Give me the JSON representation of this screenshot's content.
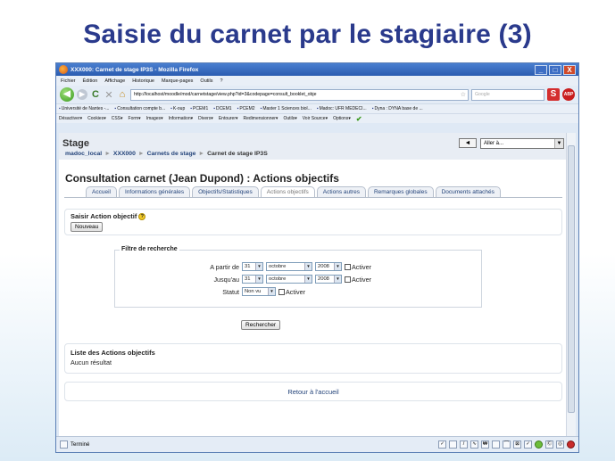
{
  "slide": {
    "title": "Saisie du carnet par le stagiaire (3)"
  },
  "window": {
    "title": "XXX000: Carnet de stage IP3S - Mozilla Firefox",
    "min": "_",
    "max": "□",
    "close": "X"
  },
  "menu": [
    "Fichier",
    "Édition",
    "Affichage",
    "Historique",
    "Marque-pages",
    "Outils",
    "?"
  ],
  "nav": {
    "back": "◀",
    "forward": "▶",
    "reload": "C",
    "stop": "✕",
    "home": "⌂",
    "url": "http://localhost/moodle/mod/carnetstage/view.php?id=3&codepage=consult_booklet_obje",
    "search_placeholder": "Google",
    "s_icon": "S",
    "abp_icon": "ABP"
  },
  "bookmarks": [
    "Université de Nantes -...",
    "Consultation compte b...",
    "K-oup",
    "PCEM1",
    "DCEM1",
    "PCEM2",
    "Master 1 Sciences biol...",
    "Madoc: UFR MEDECI...",
    "Dyna : DYNA base de ..."
  ],
  "addons": [
    "Désactiver▾",
    "Cookies▾",
    "CSS▾",
    "Form▾",
    "Images▾",
    "Information▾",
    "Divers▾",
    "Entourer▾",
    "Redimensionner▾",
    "Outils▾",
    "Voir Source▾",
    "Options▾"
  ],
  "page": {
    "site_name": "Stage",
    "jump_arrow": "◄",
    "jump_placeholder": "Aller à...",
    "breadcrumb": [
      "madoc_local",
      "XXX000",
      "Carnets de stage",
      "Carnet de stage IP3S"
    ],
    "heading": "Consultation carnet (Jean Dupond) : Actions objectifs",
    "tabs": [
      "Accueil",
      "Informations générales",
      "Objectifs/Statistiques",
      "Actions objectifs",
      "Actions autres",
      "Remarques globales",
      "Documents attachés"
    ],
    "active_tab": 3,
    "saisir_label": "Saisir Action objectif",
    "help_icon": "?",
    "new_button": "Nouveau",
    "filter": {
      "legend": "Filtre de recherche",
      "from_label": "A partir de",
      "to_label": "Jusqu'au",
      "status_label": "Statut",
      "from": {
        "day": "31",
        "month": "octobre",
        "year": "2008"
      },
      "to": {
        "day": "31",
        "month": "octobre",
        "year": "2008"
      },
      "activate": "Activer",
      "status_value": "Non vu",
      "search_button": "Rechercher"
    },
    "list_title": "Liste des Actions objectifs",
    "list_empty": "Aucun résultat",
    "back_link": "Retour à l'accueil"
  },
  "status": {
    "text": "Terminé"
  },
  "colors": {
    "slide_title": "#2a3a8c",
    "link": "#24447a",
    "titlebar": "#2b5cb0"
  }
}
